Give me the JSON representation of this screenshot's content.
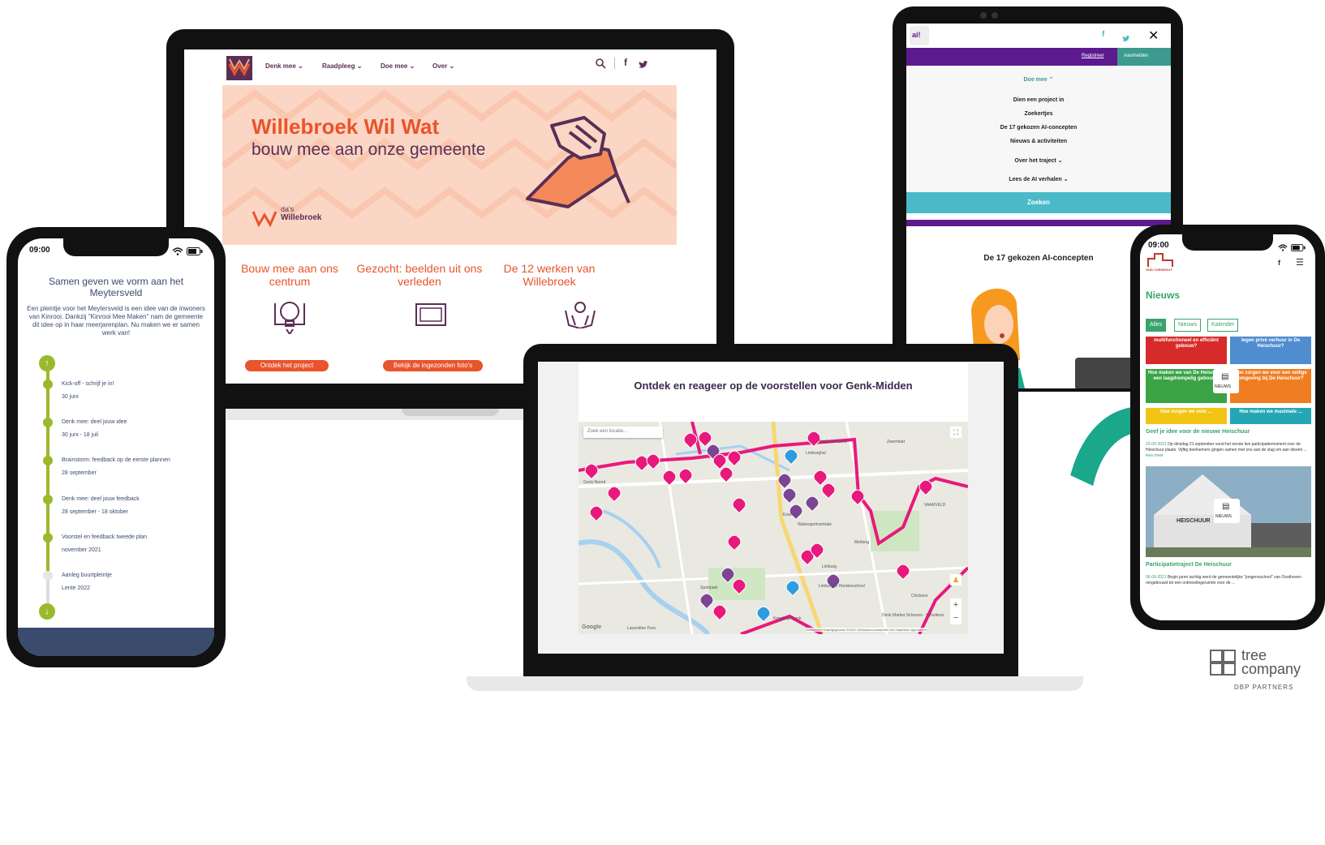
{
  "laptop1": {
    "nav": [
      "Denk mee",
      "Raadpleeg",
      "Doe mee",
      "Over"
    ],
    "hero_title": "Willebroek Wil Wat",
    "hero_subtitle": "bouw mee aan onze gemeente",
    "brand_small": "da's",
    "brand_name": "Willebroek",
    "columns": [
      {
        "title": "Bouw mee aan ons centrum",
        "button": "Ontdek het project"
      },
      {
        "title": "Gezocht: beelden uit ons verleden",
        "button": "Bekijk de ingezonden foto's"
      },
      {
        "title": "De 12 werken van Willebroek",
        "button": ""
      }
    ]
  },
  "tablet": {
    "register_link": "Registreer",
    "login_button": "Aanmelden",
    "menu_open": "Doe mee",
    "menu_items": [
      "Dien een project in",
      "Zoekertjes",
      "De 17 gekozen AI-concepten",
      "Nieuws & activiteiten"
    ],
    "menu_sub": [
      "Over het traject",
      "Lees de AI verhalen"
    ],
    "search_button": "Zoeken",
    "section_title": "De 17 gekozen AI-concepten",
    "logo_text": "ai!"
  },
  "phone1": {
    "time": "09:00",
    "title": "Samen geven we vorm aan het Meytersveld",
    "body": "Een pleintje voor het Meytersveld is een idee van de inwoners van Kinrooi. Dankzij \"Kinrooi Mee Maken\" nam de gemeente dit idee op in haar meerjarenplan. Nu maken we er samen werk van!",
    "timeline": [
      {
        "label": "Kick-off - schrijf je in!",
        "date": "30 juni"
      },
      {
        "label": "Denk mee: deel jouw idee",
        "date": "30 juni - 18 juli"
      },
      {
        "label": "Brainstorm: feedback op de eerste plannen",
        "date": "28 september"
      },
      {
        "label": "Denk mee: deel jouw feedback",
        "date": "28 september - 18 oktober"
      },
      {
        "label": "Voorstel en feedback tweede plan",
        "date": "november 2021"
      },
      {
        "label": "Aanleg buurtpleintje",
        "date": "Lente 2022"
      }
    ]
  },
  "laptop2": {
    "title": "Ontdek en reageer op de voorstellen voor Genk-Midden",
    "search_placeholder": "Zoek een locatie...",
    "map_labels": [
      "Limburghal",
      "Stadhoek Genk",
      "Watersportcentrale",
      "Limburgse Hondenschool",
      "Metberg",
      "Kringloop Genk",
      "Lavendine Puro",
      "Essenzi",
      "Drink Market Schreurs - Scholtens",
      "Chickens",
      "Sportpark",
      "Limburg",
      "VAARVELD",
      "Genk-Noord",
      "Zwembad",
      "Google",
      "Sneltoetsen",
      "Kaartgegevens ©2021",
      "Gebruiksvoorwaarden",
      "Een kaartfout rapporteren"
    ]
  },
  "phone2": {
    "time": "09:00",
    "brand": "OUD-TURNHOUT",
    "heading": "Nieuws",
    "filters": [
      "Alles",
      "Nieuws",
      "Kalender"
    ],
    "tiles": [
      {
        "text": "multifunctioneel en efficiënt gebouw?",
        "color": "#d72b2b"
      },
      {
        "text": "tegen privé verhuur in De Heischuur?",
        "color": "#4f8dcf"
      },
      {
        "text": "Hoe maken we van De Heischuur een laagdrempelig gebouw?",
        "color": "#3aa346"
      },
      {
        "text": "Hoe zorgen we voor een veilige omgeving bij De Heischuur?",
        "color": "#ef7d22"
      },
      {
        "text": "Hoe zorgen we voor ...",
        "color": "#f2c414"
      },
      {
        "text": "Hoe maken we maximale ...",
        "color": "#25a6b5"
      }
    ],
    "badge": "NIEUWS",
    "article1_title": "Geef je idee voor de nieuwe Heischuur",
    "article1_date": "22-09-2021",
    "article1_text": "Op dinsdag 21 september vond het eerste live participatiemoment over de Heischuur plaats. Vijftig deelnemers gingen samen met ons aan de slag om aan ideeën ...",
    "article1_more": "lees meer",
    "building_sign": "HEISCHUUR",
    "article2_title": "Participatietraject De Heischuur",
    "article2_date": "06-09-2021",
    "article2_text": "Begin jaren tachtig werd de gemeentelijke \"jongensschool\" van Oosthoven omgebouwd tot een ontmoetingsruimte voor de ..."
  },
  "footer": {
    "company_line1": "tree",
    "company_line2": "company",
    "partners": "DBP PARTNERS"
  },
  "colors": {
    "willebroek_orange": "#e8542c",
    "willebroek_purple": "#5a2f55",
    "ai_purple": "#5b1a8e",
    "ai_teal": "#4ab9c8",
    "kinrooi_green": "#9ab92b",
    "genk_pink": "#e8197d",
    "genk_purple": "#7b4593",
    "tree_green": "#1aa78a"
  }
}
